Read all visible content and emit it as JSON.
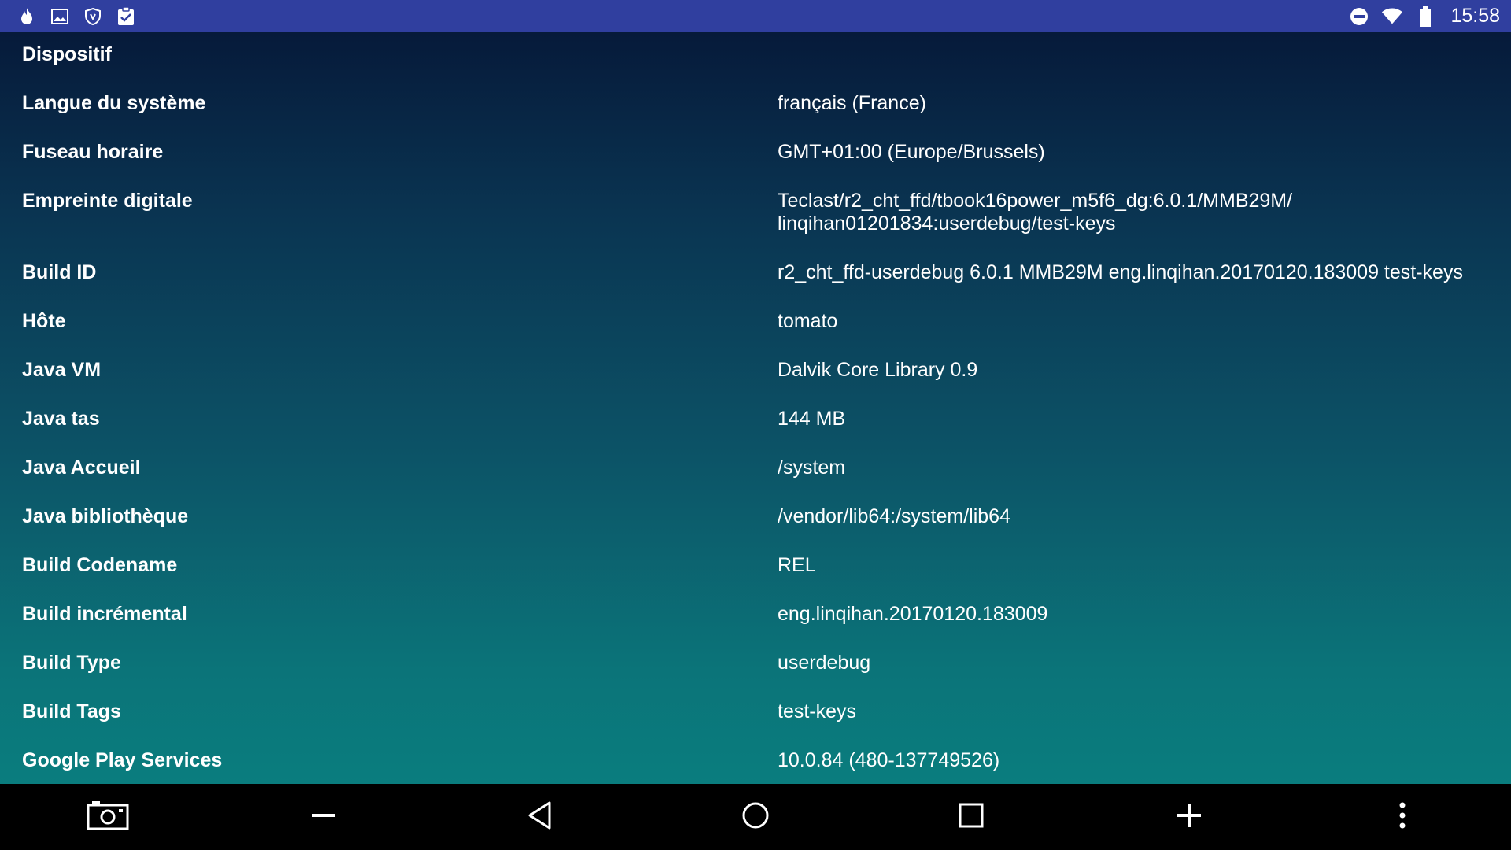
{
  "status_bar": {
    "left_icons": [
      "flame-icon",
      "image-icon",
      "shield-icon",
      "clipboard-check-icon"
    ],
    "right_icons": [
      "do-not-disturb-icon",
      "wifi-icon",
      "battery-icon"
    ],
    "time": "15:58"
  },
  "section": {
    "title": "Dispositif"
  },
  "rows": [
    {
      "key": "Langue du système",
      "value": "français (France)"
    },
    {
      "key": "Fuseau horaire",
      "value": "GMT+01:00 (Europe/Brussels)"
    },
    {
      "key": "Empreinte digitale",
      "value": "Teclast/r2_cht_ffd/tbook16power_m5f6_dg:6.0.1/MMB29M/\nlinqihan01201834:userdebug/test-keys"
    },
    {
      "key": "Build ID",
      "value": "r2_cht_ffd-userdebug 6.0.1 MMB29M eng.linqihan.20170120.183009 test-keys"
    },
    {
      "key": "Hôte",
      "value": "tomato"
    },
    {
      "key": "Java VM",
      "value": "Dalvik Core Library 0.9"
    },
    {
      "key": "Java tas",
      "value": "144 MB"
    },
    {
      "key": "Java Accueil",
      "value": "/system"
    },
    {
      "key": "Java bibliothèque",
      "value": "/vendor/lib64:/system/lib64"
    },
    {
      "key": "Build Codename",
      "value": "REL"
    },
    {
      "key": "Build incrémental",
      "value": "eng.linqihan.20170120.183009"
    },
    {
      "key": "Build Type",
      "value": "userdebug"
    },
    {
      "key": "Build Tags",
      "value": "test-keys"
    },
    {
      "key": "Google Play Services",
      "value": "10.0.84 (480-137749526)"
    }
  ],
  "nav_bar": {
    "buttons": [
      "screenshot-icon",
      "volume-down-icon",
      "back-icon",
      "home-icon",
      "recents-icon",
      "volume-up-icon",
      "more-vertical-icon"
    ]
  }
}
